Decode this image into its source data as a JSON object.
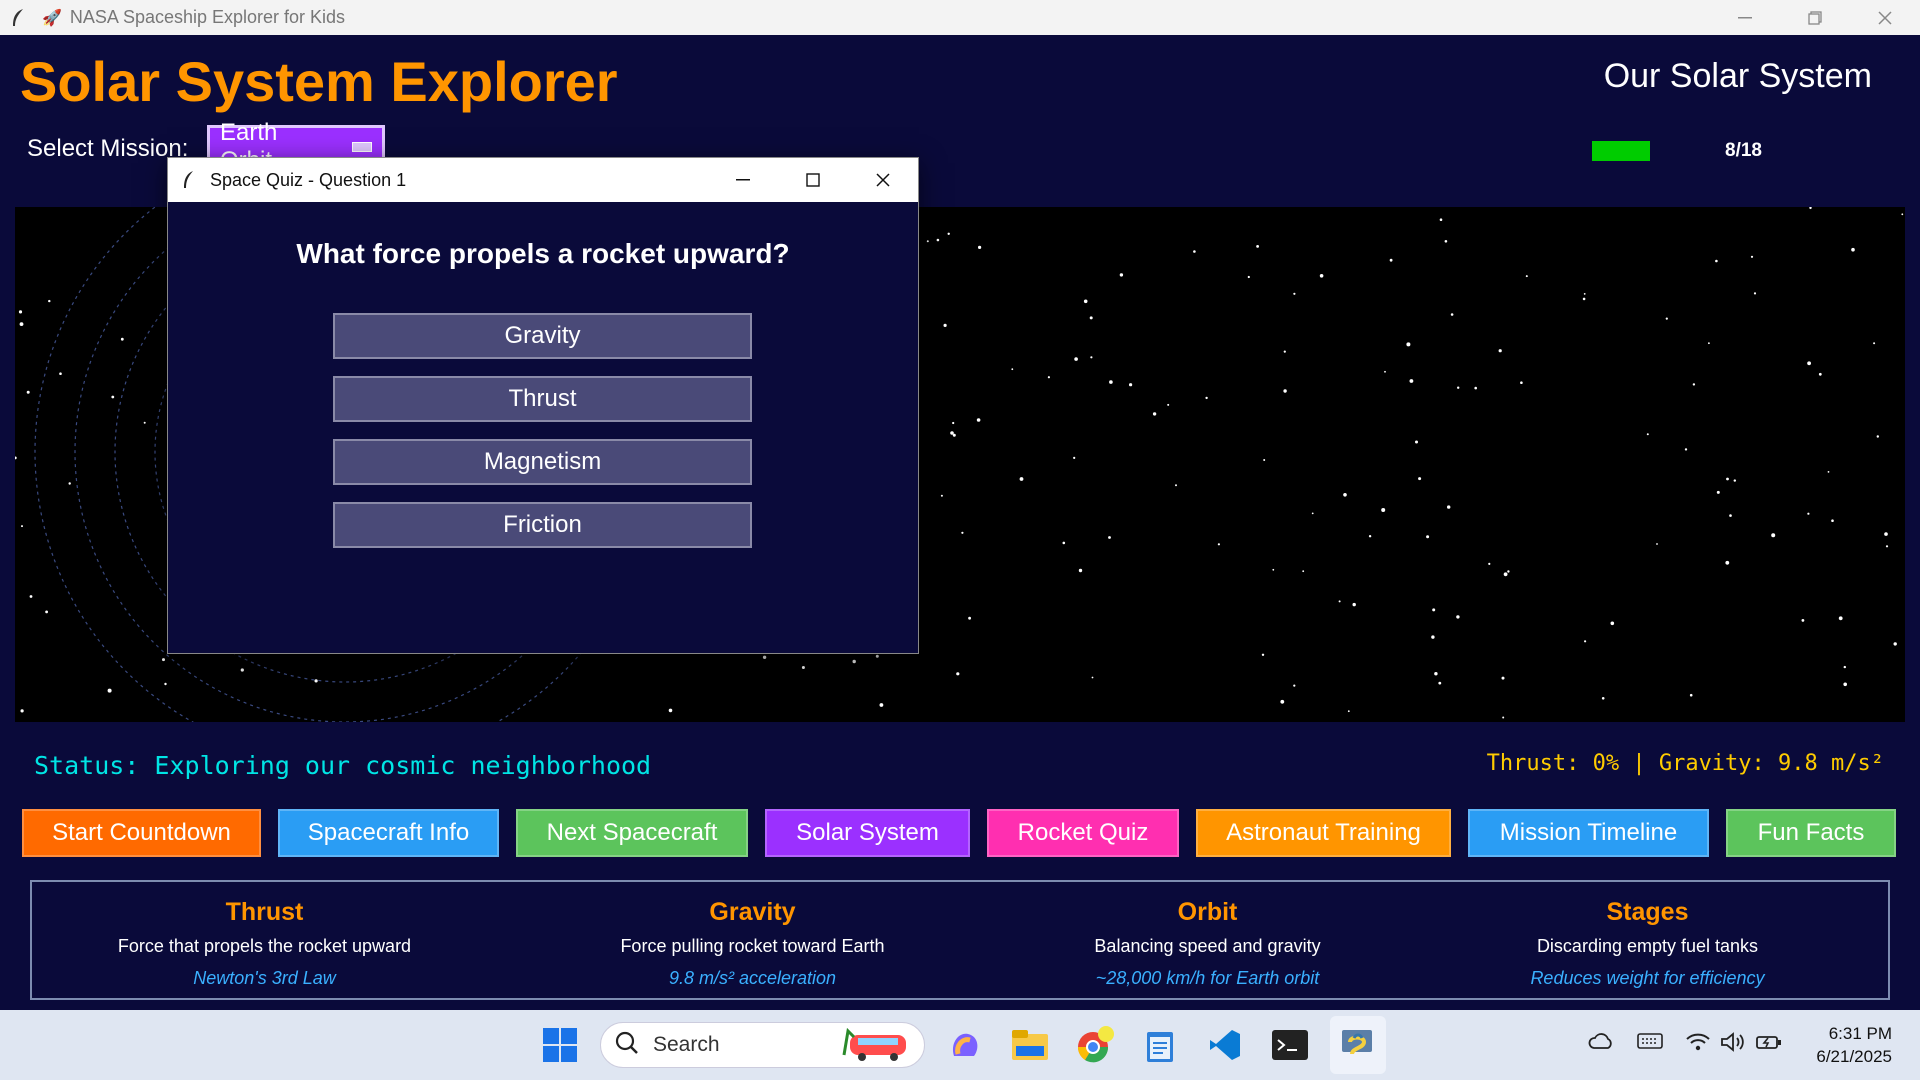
{
  "window": {
    "title": "NASA Spaceship Explorer for Kids"
  },
  "header": {
    "title": "Solar System Explorer",
    "view_name": "Our Solar System",
    "mission_label": "Select Mission:",
    "mission_value": "Earth Orbit",
    "progress_text": "8/18",
    "progress_fraction": 0.44
  },
  "status": {
    "text": "Status: Exploring our cosmic neighborhood",
    "readout": "Thrust: 0% | Gravity: 9.8 m/s²"
  },
  "buttons": [
    {
      "label": "Start Countdown",
      "color": "#ff6a00"
    },
    {
      "label": "Spacecraft Info",
      "color": "#2a9df4"
    },
    {
      "label": "Next Spacecraft",
      "color": "#5cc45c"
    },
    {
      "label": "Solar System",
      "color": "#9b30ff"
    },
    {
      "label": "Rocket Quiz",
      "color": "#ff2fb0"
    },
    {
      "label": "Astronaut Training",
      "color": "#ff9500"
    },
    {
      "label": "Mission Timeline",
      "color": "#2a9df4"
    },
    {
      "label": "Fun Facts",
      "color": "#5cc45c"
    }
  ],
  "info_panel": [
    {
      "heading": "Thrust",
      "desc": "Force that propels the rocket upward",
      "note": "Newton's 3rd Law"
    },
    {
      "heading": "Gravity",
      "desc": "Force pulling rocket toward Earth",
      "note": "9.8 m/s² acceleration"
    },
    {
      "heading": "Orbit",
      "desc": "Balancing speed and gravity",
      "note": "~28,000 km/h for Earth orbit"
    },
    {
      "heading": "Stages",
      "desc": "Discarding empty fuel tanks",
      "note": "Reduces weight for efficiency"
    }
  ],
  "dialog": {
    "title": "Space Quiz - Question 1",
    "question": "What force propels a rocket upward?",
    "answers": [
      "Gravity",
      "Thrust",
      "Magnetism",
      "Friction"
    ]
  },
  "taskbar": {
    "search_placeholder": "Search",
    "time": "6:31 PM",
    "date": "6/21/2025"
  }
}
